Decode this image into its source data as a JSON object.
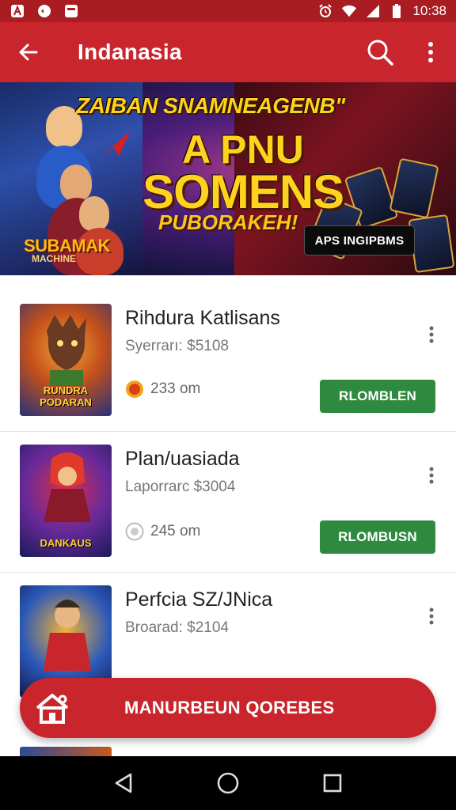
{
  "status_bar": {
    "time": "10:38",
    "icons": [
      "font-icon",
      "whatsapp-icon",
      "notification-icon",
      "alarm-icon",
      "wifi-icon",
      "signal-icon",
      "battery-icon"
    ]
  },
  "app_bar": {
    "title": "Indanasia",
    "icons": [
      "back-arrow-icon",
      "search-icon",
      "more-vert-icon"
    ]
  },
  "banner": {
    "headline_top": "ZAIBAN SNAMNEAGENB\"",
    "headline_line1": "A PNU",
    "headline_line2": "SOMENS",
    "headline_line3": "PUBORAKEH!",
    "badge": "APS INGIPBMS",
    "logo_text": "SUBAMAK",
    "logo_sub": "MACHINE"
  },
  "apps": [
    {
      "title": "Rihdura Katlisans",
      "subtitle": "Syerrarı: $5108",
      "meta": "233 om",
      "button": "RLOMBLEN",
      "thumb_label": "RUNDRA PODARAN",
      "colors": [
        "#f28a1c",
        "#2a3d8f"
      ]
    },
    {
      "title": "Plan/uasiada",
      "subtitle": "Laporrarc $3004",
      "meta": "245 om",
      "button": "RLOMBUSN",
      "thumb_label": "DANKAUS",
      "colors": [
        "#e23c2a",
        "#3b2a8a"
      ]
    },
    {
      "title": "Perfcia SZ/JNica",
      "subtitle": "Broarad: $2104",
      "meta": "",
      "button": "",
      "thumb_label": "",
      "colors": [
        "#e2a42a",
        "#1d3f8e"
      ]
    }
  ],
  "fab": {
    "label": "MANURBEUN QOREBES"
  },
  "nav": [
    "back-triangle-icon",
    "home-circle-icon",
    "recents-square-icon"
  ]
}
